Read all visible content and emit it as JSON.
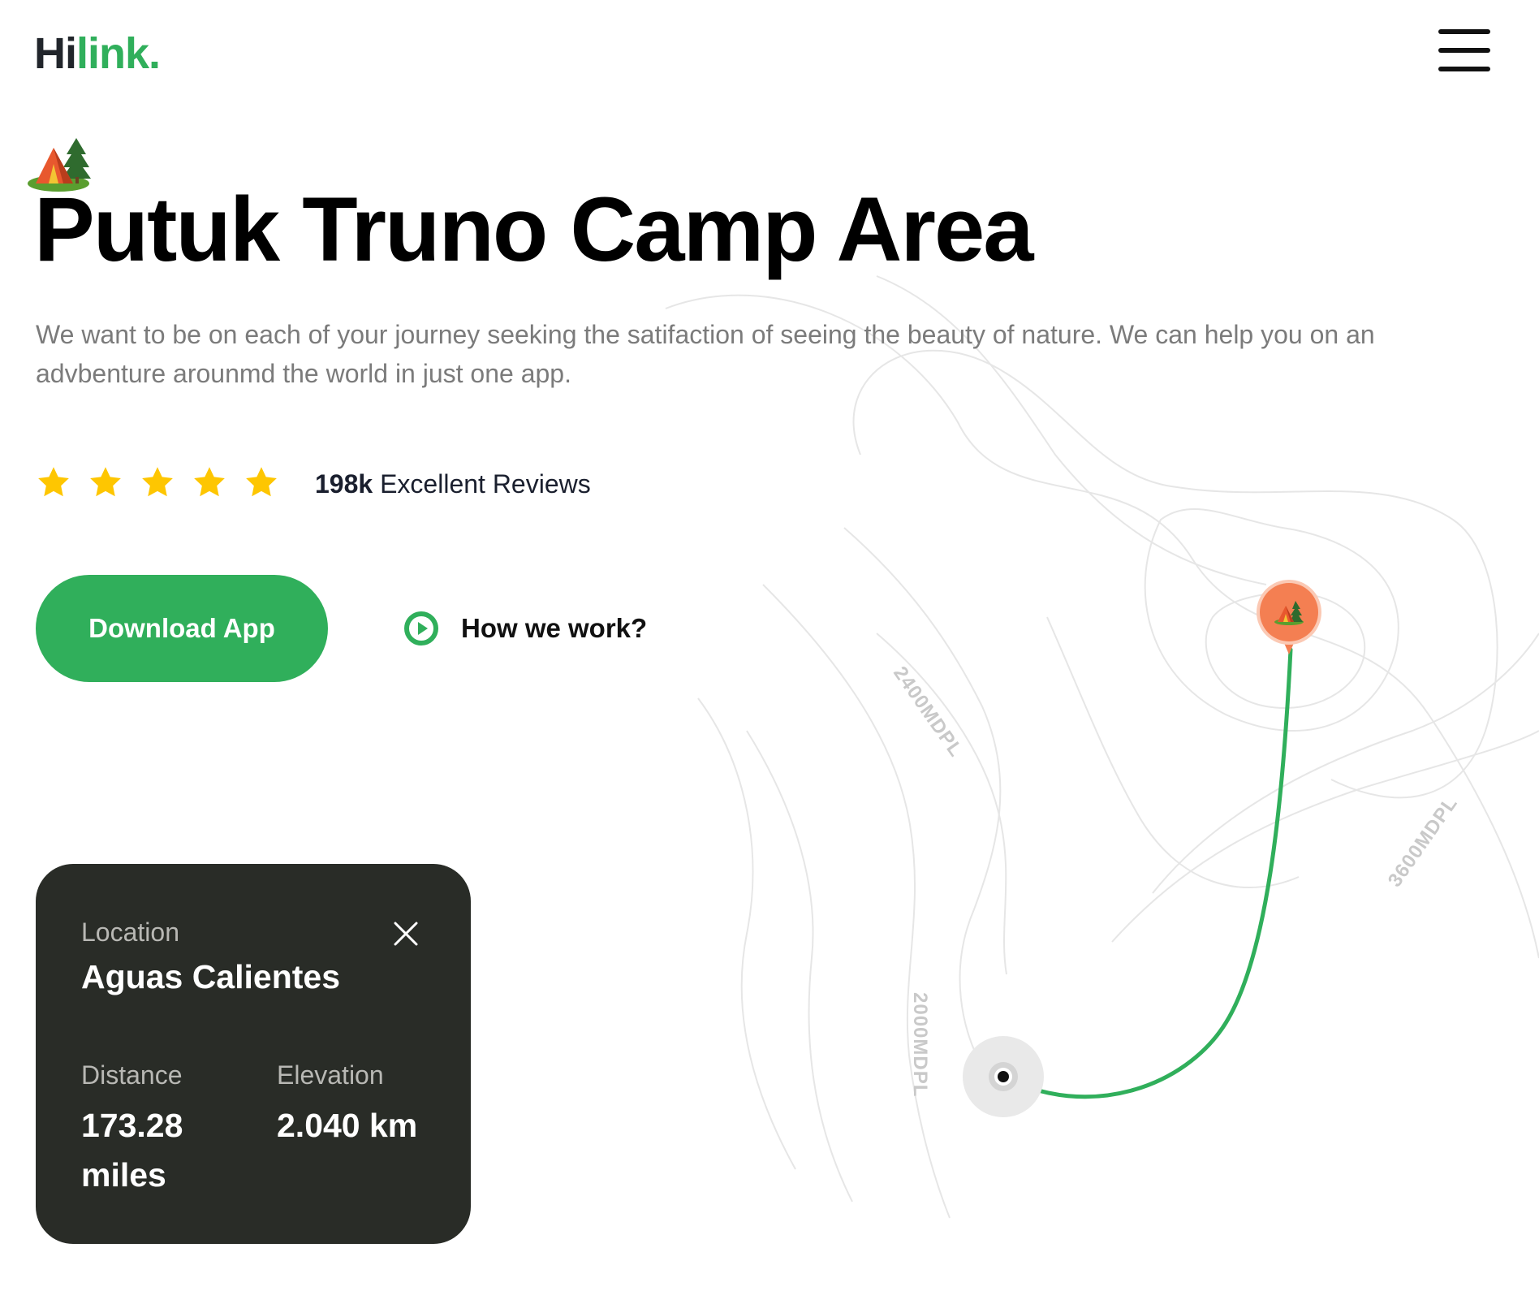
{
  "header": {
    "logo_part1": "Hi",
    "logo_part2": "link.",
    "menu_icon": "hamburger-menu-icon"
  },
  "hero": {
    "emoji_icon": "camping-tent-icon",
    "title": "Putuk Truno Camp Area",
    "description": "We want to be on each of your journey seeking the satifaction of seeing the beauty of nature. We can help you on an advbenture arounmd the world in just one app."
  },
  "rating": {
    "stars": 5,
    "star_icon": "star-icon",
    "count": "198k",
    "label": "Excellent Reviews"
  },
  "actions": {
    "download_label": "Download App",
    "how_label": "How we work?",
    "play_icon": "play-circle-icon"
  },
  "location_card": {
    "location_label": "Location",
    "location_value": "Aguas Calientes",
    "distance_label": "Distance",
    "distance_value": "173.28 miles",
    "elevation_label": "Elevation",
    "elevation_value": "2.040 km",
    "close_icon": "close-icon"
  },
  "map": {
    "contour_labels": [
      "2400MDPL",
      "3600MDPL",
      "2000MDPL"
    ],
    "route_color": "#30af5b",
    "pin_color": "#f47f52"
  },
  "colors": {
    "brand_green": "#30af5b",
    "dark_card": "#292c27",
    "star_yellow": "#fec601",
    "text_gray": "#7b7b7b"
  }
}
